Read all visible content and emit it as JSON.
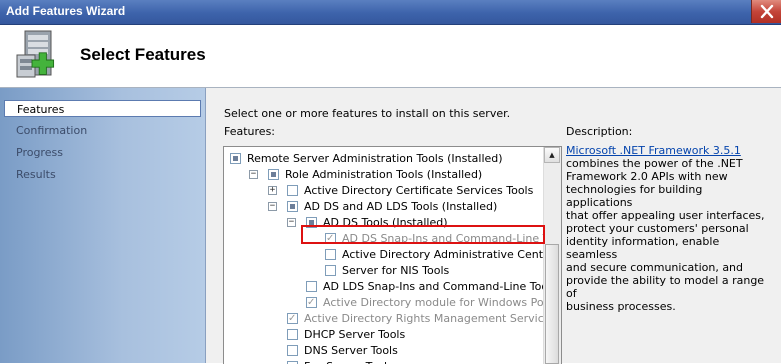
{
  "window": {
    "title": "Add Features Wizard"
  },
  "header": {
    "title": "Select Features"
  },
  "nav": {
    "items": [
      {
        "label": "Features",
        "active": true
      },
      {
        "label": "Confirmation",
        "active": false
      },
      {
        "label": "Progress",
        "active": false
      },
      {
        "label": "Results",
        "active": false
      }
    ]
  },
  "main": {
    "instructions": "Select one or more features to install on this server.",
    "features_label": "Features:",
    "description_label": "Description:",
    "description_link": "Microsoft .NET Framework 3.5.1",
    "description_lines": [
      "combines the power of the .NET",
      "Framework 2.0 APIs with new",
      "technologies for building applications",
      "that offer appealing user interfaces,",
      "protect your customers' personal",
      "identity information, enable seamless",
      "and secure communication, and",
      "provide the ability to model a range of",
      "business processes."
    ]
  },
  "tree": {
    "items": [
      {
        "label": "Remote Server Administration Tools  (Installed)",
        "level": 0,
        "expander": "",
        "state": "partial",
        "disabled": false
      },
      {
        "label": "Role Administration Tools  (Installed)",
        "level": 1,
        "expander": "−",
        "state": "partial",
        "disabled": false
      },
      {
        "label": "Active Directory Certificate Services Tools",
        "level": 2,
        "expander": "+",
        "state": "unchecked",
        "disabled": false
      },
      {
        "label": "AD DS and AD LDS Tools  (Installed)",
        "level": 2,
        "expander": "−",
        "state": "partial",
        "disabled": false
      },
      {
        "label": "AD DS Tools  (Installed)",
        "level": 3,
        "expander": "−",
        "state": "partial",
        "disabled": false
      },
      {
        "label": "AD DS Snap-Ins and Command-Line Tools  (In",
        "level": 4,
        "expander": "",
        "state": "checked",
        "disabled": true
      },
      {
        "label": "Active Directory Administrative Center",
        "level": 4,
        "expander": "",
        "state": "unchecked",
        "disabled": false
      },
      {
        "label": "Server for NIS Tools",
        "level": 4,
        "expander": "",
        "state": "unchecked",
        "disabled": false
      },
      {
        "label": "AD LDS Snap-Ins and Command-Line Tools",
        "level": 3,
        "expander": "",
        "state": "unchecked",
        "disabled": false
      },
      {
        "label": "Active Directory module for Windows PowerShell",
        "level": 3,
        "expander": "",
        "state": "checked",
        "disabled": true
      },
      {
        "label": "Active Directory Rights Management Services Tools  (",
        "level": 2,
        "expander": "",
        "state": "checked",
        "disabled": true
      },
      {
        "label": "DHCP Server Tools",
        "level": 2,
        "expander": "",
        "state": "unchecked",
        "disabled": false
      },
      {
        "label": "DNS Server Tools",
        "level": 2,
        "expander": "",
        "state": "unchecked",
        "disabled": false
      },
      {
        "label": "Fax Server Tools",
        "level": 2,
        "expander": "",
        "state": "unchecked",
        "disabled": false
      }
    ]
  },
  "colors": {
    "highlight": "#dd1111",
    "link": "#0645ad",
    "titlebar": "#3d63ab"
  },
  "icons": {
    "wizard": "server-add-icon",
    "close": "close-icon"
  }
}
